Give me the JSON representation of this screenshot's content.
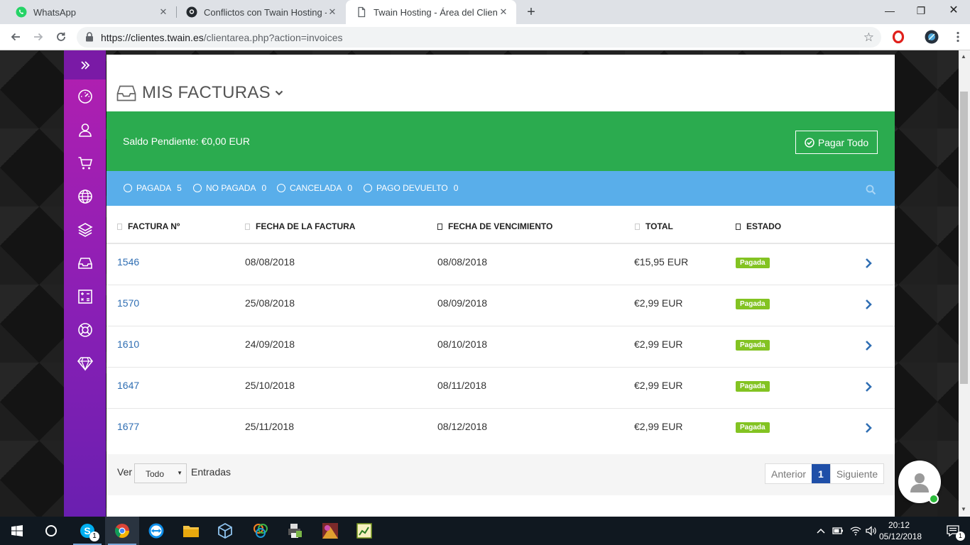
{
  "browser": {
    "tabs": [
      {
        "label": "WhatsApp",
        "icon": "whatsapp-icon",
        "active": false
      },
      {
        "label": "Conflictos con Twain Hosting - D",
        "icon": "github-icon",
        "active": false
      },
      {
        "label": "Twain Hosting - Área del Cliente",
        "icon": "page-icon",
        "active": true
      }
    ],
    "new_tab": "+",
    "url_host": "https://clientes.twain.es",
    "url_path": "/clientarea.php?action=invoices"
  },
  "sidebar": {
    "items": [
      "dashboard-icon",
      "user-icon",
      "cart-icon",
      "globe-icon",
      "layers-icon",
      "inbox-icon",
      "calculator-icon",
      "lifebuoy-icon",
      "diamond-icon"
    ]
  },
  "page": {
    "title": "MIS FACTURAS",
    "balance": "Saldo Pendiente: €0,00 EUR",
    "pay_all": "Pagar Todo",
    "filters": [
      {
        "label": "PAGADA",
        "count": "5"
      },
      {
        "label": "NO PAGADA",
        "count": "0"
      },
      {
        "label": "CANCELADA",
        "count": "0"
      },
      {
        "label": "PAGO DEVUELTO",
        "count": "0"
      }
    ],
    "columns": [
      "FACTURA Nº",
      "FECHA DE LA FACTURA",
      "FECHA DE VENCIMIENTO",
      "TOTAL",
      "ESTADO"
    ],
    "rows": [
      {
        "invoice": "1546",
        "date": "08/08/2018",
        "due": "08/08/2018",
        "total": "€15,95 EUR",
        "status": "Pagada"
      },
      {
        "invoice": "1570",
        "date": "25/08/2018",
        "due": "08/09/2018",
        "total": "€2,99 EUR",
        "status": "Pagada"
      },
      {
        "invoice": "1610",
        "date": "24/09/2018",
        "due": "08/10/2018",
        "total": "€2,99 EUR",
        "status": "Pagada"
      },
      {
        "invoice": "1647",
        "date": "25/10/2018",
        "due": "08/11/2018",
        "total": "€2,99 EUR",
        "status": "Pagada"
      },
      {
        "invoice": "1677",
        "date": "25/11/2018",
        "due": "08/12/2018",
        "total": "€2,99 EUR",
        "status": "Pagada"
      }
    ],
    "show_label": "Ver",
    "entries_value": "Todo",
    "entries_label": "Entradas",
    "pager": {
      "prev": "Anterior",
      "current": "1",
      "next": "Siguiente"
    }
  },
  "taskbar": {
    "time": "20:12",
    "date": "05/12/2018",
    "skype_badge": "1",
    "notification_badge": "1"
  },
  "colors": {
    "sidebar": "#9b1fb3",
    "green": "#2bab4f",
    "blue": "#59aeea",
    "badge": "#83c322",
    "link": "#2f6eb3"
  }
}
